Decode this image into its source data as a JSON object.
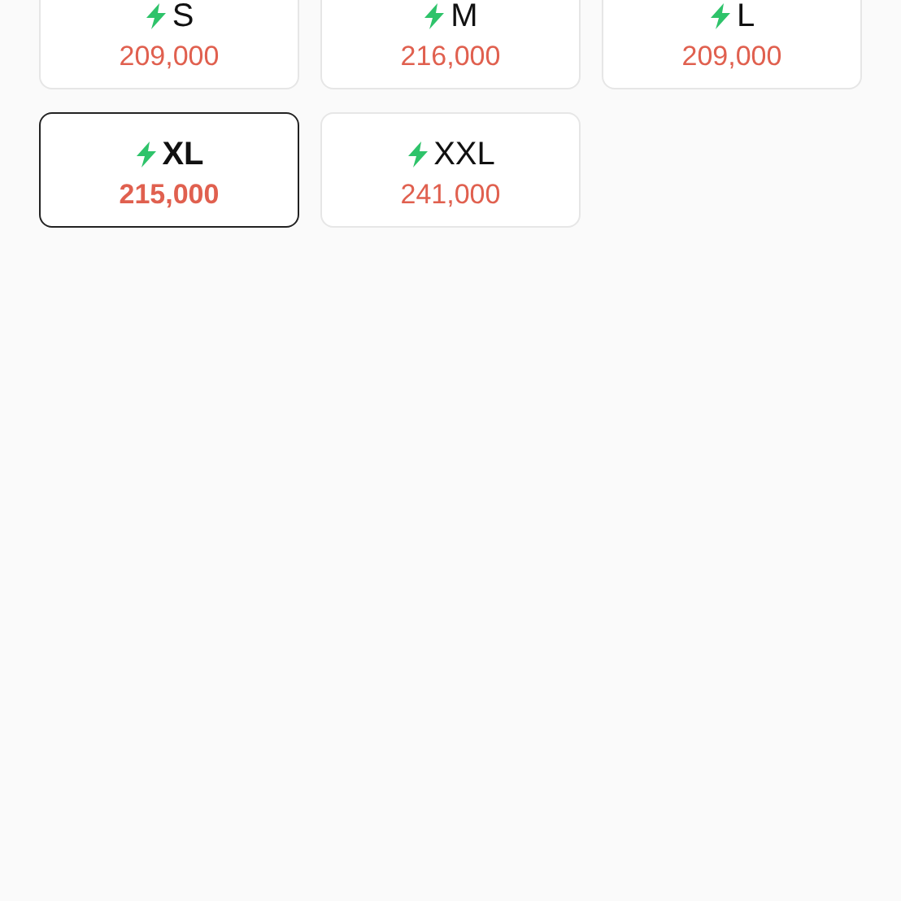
{
  "sizes": [
    {
      "label": "S",
      "price": "209,000",
      "selected": false
    },
    {
      "label": "M",
      "price": "216,000",
      "selected": false
    },
    {
      "label": "L",
      "price": "209,000",
      "selected": false
    },
    {
      "label": "XL",
      "price": "215,000",
      "selected": true
    },
    {
      "label": "XXL",
      "price": "241,000",
      "selected": false
    }
  ]
}
